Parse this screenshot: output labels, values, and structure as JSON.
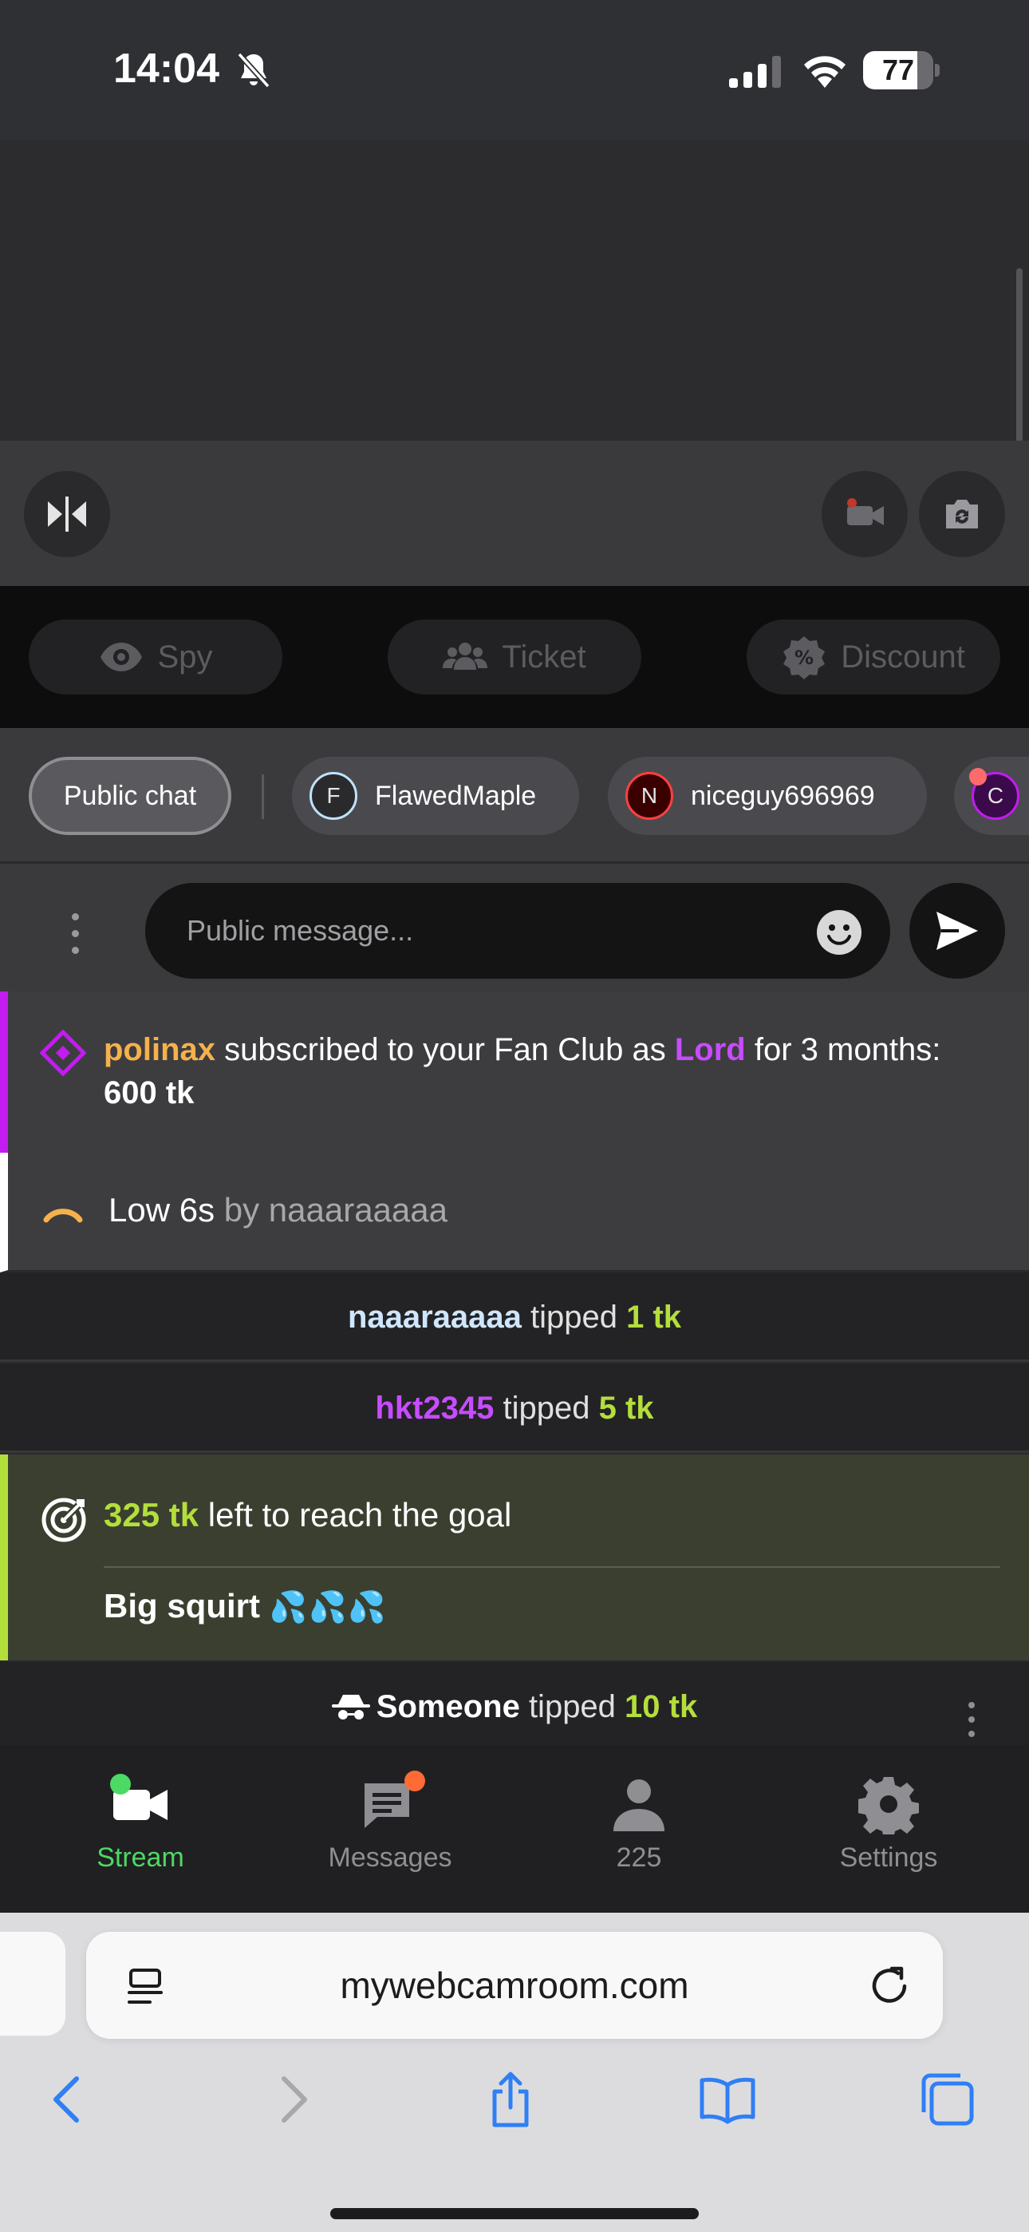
{
  "status": {
    "time": "14:04",
    "battery": "77",
    "battery_level": 0.77
  },
  "modes": {
    "spy": "Spy",
    "ticket": "Ticket",
    "discount": "Discount"
  },
  "tabs": [
    {
      "label": "Public chat"
    },
    {
      "label": "FlawedMaple",
      "initial": "F",
      "color": "#bfe3ff"
    },
    {
      "label": "niceguy696969",
      "initial": "N",
      "color": "#ff4040"
    },
    {
      "initial": "C",
      "color": "#c21cf0"
    }
  ],
  "input": {
    "placeholder": "Public message..."
  },
  "feed": {
    "subscription": {
      "user": "polinax",
      "text1": " subscribed to your Fan Club as ",
      "tier": "Lord",
      "text2": " for 3 months: ",
      "amount": "600 tk"
    },
    "menu": {
      "item": "Low 6s",
      "by": " by ",
      "user": "naaaraaaaa"
    },
    "tips": [
      {
        "user": "naaaraaaaa",
        "text": " tipped ",
        "amount": "1 tk"
      },
      {
        "user": "hkt2345",
        "text": " tipped ",
        "amount": "5 tk"
      }
    ],
    "goal": {
      "amount": "325 tk",
      "text": " left to reach the goal",
      "title": "Big squirt",
      "drops": "💦💦💦"
    },
    "someone": {
      "user": "Someone",
      "text": " tipped ",
      "amount": "10 tk"
    }
  },
  "nav": {
    "stream": "Stream",
    "messages": "Messages",
    "users": "225",
    "settings": "Settings",
    "accent": "#4cd964",
    "badge": "#ff6b35"
  },
  "browser": {
    "url": "mywebcamroom.com"
  }
}
